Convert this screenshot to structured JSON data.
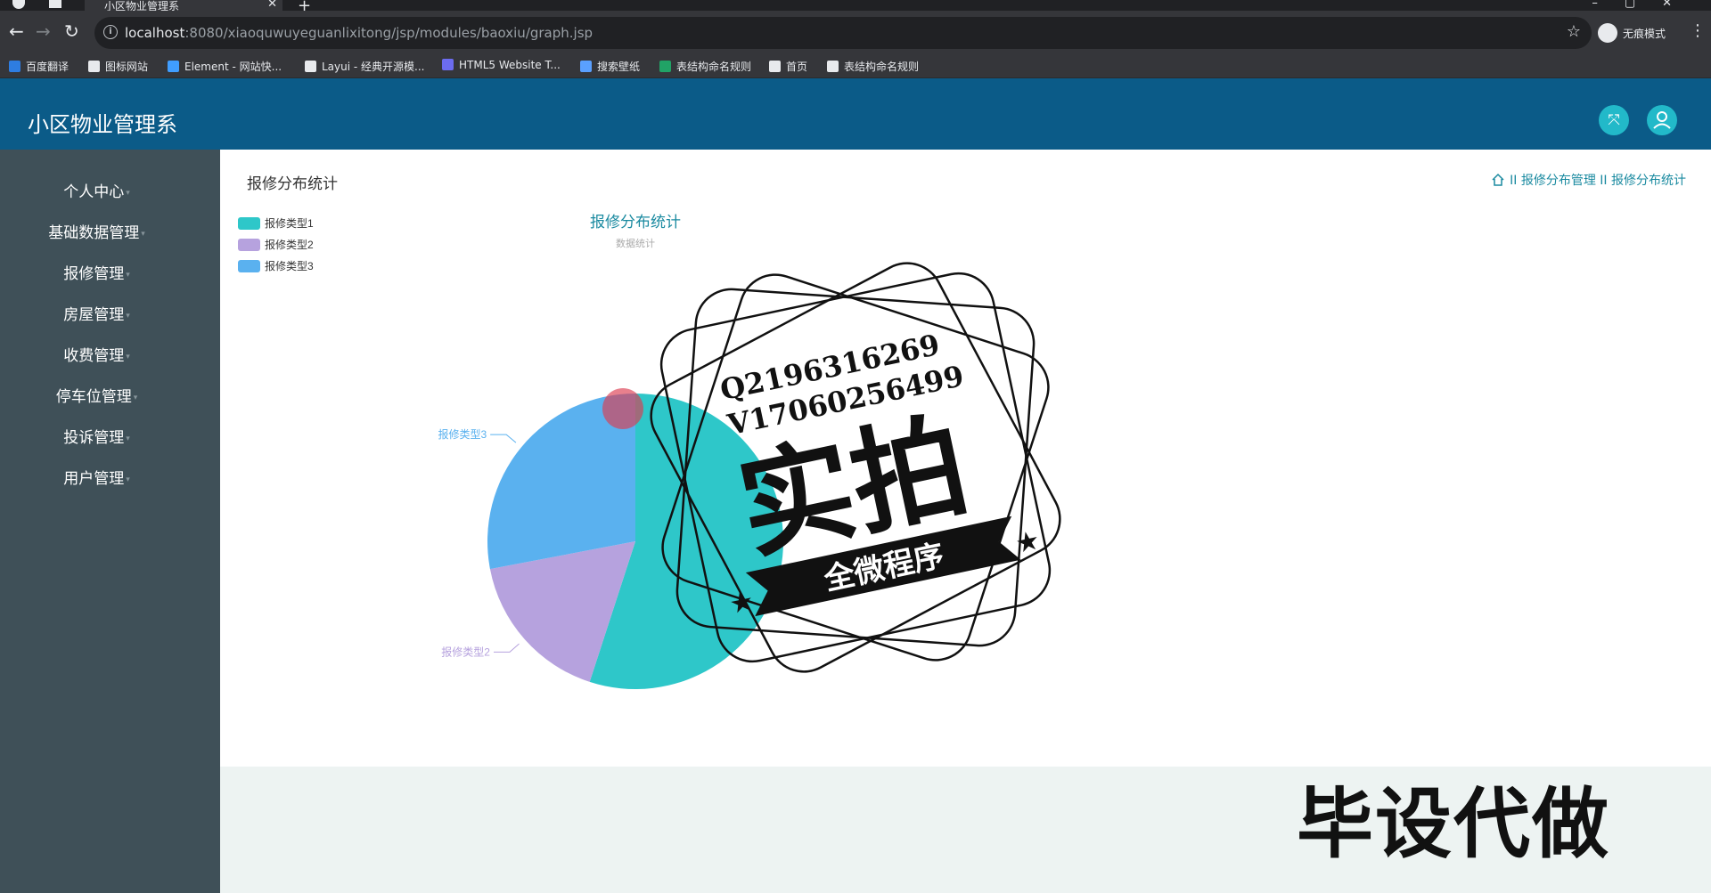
{
  "browser": {
    "tab_title": "小区物业管理系",
    "url_host": "localhost",
    "url_rest": ":8080/xiaoquwuyeguanlixitong/jsp/modules/baoxiu/graph.jsp",
    "incognito_label": "无痕模式",
    "bookmarks": [
      {
        "label": "百度翻译",
        "icon": "baidu-translate-icon",
        "color": "#2e7de1"
      },
      {
        "label": "图标网站",
        "icon": "flag-icon",
        "color": "#e8eaed"
      },
      {
        "label": "Element - 网站快...",
        "icon": "element-icon",
        "color": "#409eff"
      },
      {
        "label": "Layui - 经典开源模...",
        "icon": "layui-icon",
        "color": "#e8eaed"
      },
      {
        "label": "HTML5 Website T...",
        "icon": "html5-icon",
        "color": "#6c6cf0"
      },
      {
        "label": "搜索壁纸",
        "icon": "wallpaper-icon",
        "color": "#5aa0ff"
      },
      {
        "label": "表结构命名规则",
        "icon": "sheet-icon",
        "color": "#21a366"
      },
      {
        "label": "首页",
        "icon": "globe-icon",
        "color": "#e8eaed"
      },
      {
        "label": "表结构命名规则",
        "icon": "globe-icon",
        "color": "#e8eaed"
      }
    ]
  },
  "app": {
    "title": "小区物业管理系",
    "header_buttons": [
      {
        "icon": "fullscreen-icon",
        "glyph": "⤧"
      },
      {
        "icon": "user-icon",
        "glyph": "☺"
      }
    ]
  },
  "sidebar": {
    "items": [
      {
        "label": "个人中心"
      },
      {
        "label": "基础数据管理"
      },
      {
        "label": "报修管理"
      },
      {
        "label": "房屋管理"
      },
      {
        "label": "收费管理"
      },
      {
        "label": "停车位管理"
      },
      {
        "label": "投诉管理"
      },
      {
        "label": "用户管理"
      }
    ]
  },
  "page": {
    "title": "报修分布统计",
    "breadcrumb": [
      "报修分布管理",
      "报修分布统计"
    ],
    "breadcrumb_sep": "II"
  },
  "chart_data": {
    "type": "pie",
    "title": "报修分布统计",
    "subtitle": "数据统计",
    "legend_position": "top-left",
    "slices": [
      {
        "name": "报修类型1",
        "value": 55,
        "color": "#2ec7c9"
      },
      {
        "name": "报修类型2",
        "value": 17,
        "color": "#b6a2de"
      },
      {
        "name": "报修类型3",
        "value": 28,
        "color": "#5ab1ef"
      }
    ]
  },
  "watermark": {
    "contact_q": "Q2196316269",
    "contact_v": "V1706025649​9",
    "big": "实拍",
    "banner": "全微程序",
    "corner": "毕设代做"
  }
}
